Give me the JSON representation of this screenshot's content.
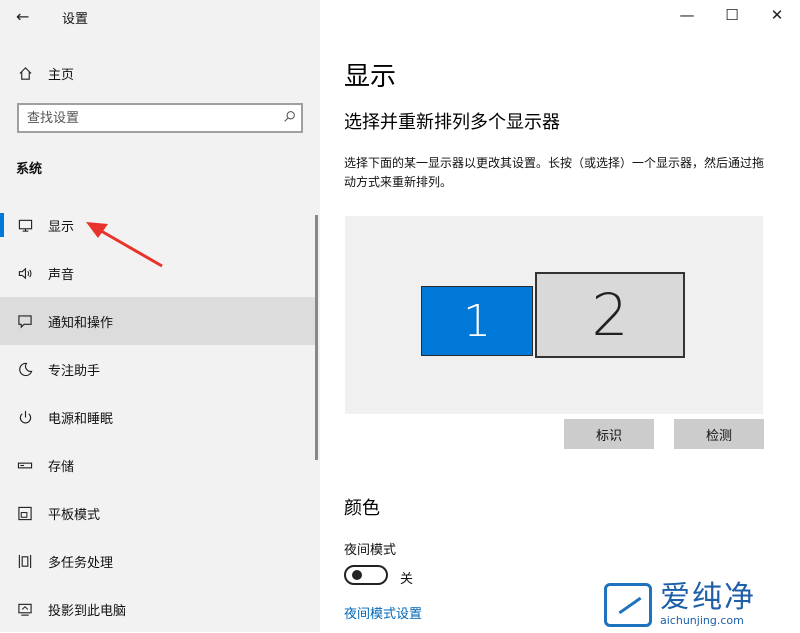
{
  "window": {
    "title": "设置",
    "back_icon": "←",
    "controls": [
      "—",
      "☐",
      "✕"
    ]
  },
  "sidebar": {
    "home": {
      "label": "主页",
      "icon": "home-icon"
    },
    "search": {
      "placeholder": "查找设置",
      "icon": "search-icon"
    },
    "section_label": "系统",
    "items": [
      {
        "label": "显示",
        "icon": "monitor-icon",
        "active": true
      },
      {
        "label": "声音",
        "icon": "speaker-icon"
      },
      {
        "label": "通知和操作",
        "icon": "notification-icon",
        "hover": true
      },
      {
        "label": "专注助手",
        "icon": "moon-icon"
      },
      {
        "label": "电源和睡眠",
        "icon": "power-icon"
      },
      {
        "label": "存储",
        "icon": "storage-icon"
      },
      {
        "label": "平板模式",
        "icon": "tablet-icon"
      },
      {
        "label": "多任务处理",
        "icon": "multitask-icon"
      },
      {
        "label": "投影到此电脑",
        "icon": "project-icon"
      }
    ]
  },
  "main": {
    "title": "显示",
    "subtitle": "选择并重新排列多个显示器",
    "description": "选择下面的某一显示器以更改其设置。长按（或选择）一个显示器，然后通过拖动方式来重新排列。",
    "monitors": [
      "1",
      "2"
    ],
    "buttons": {
      "identify": "标识",
      "detect": "检测"
    },
    "color_heading": "颜色",
    "night_mode": {
      "label": "夜间模式",
      "state": "关"
    },
    "night_link": "夜间模式设置"
  },
  "watermark": {
    "text": "爱纯净",
    "url": "aichunjing.com"
  },
  "colors": {
    "accent": "#0078d7",
    "arrow": "#e8332a",
    "link": "#0067b8"
  }
}
